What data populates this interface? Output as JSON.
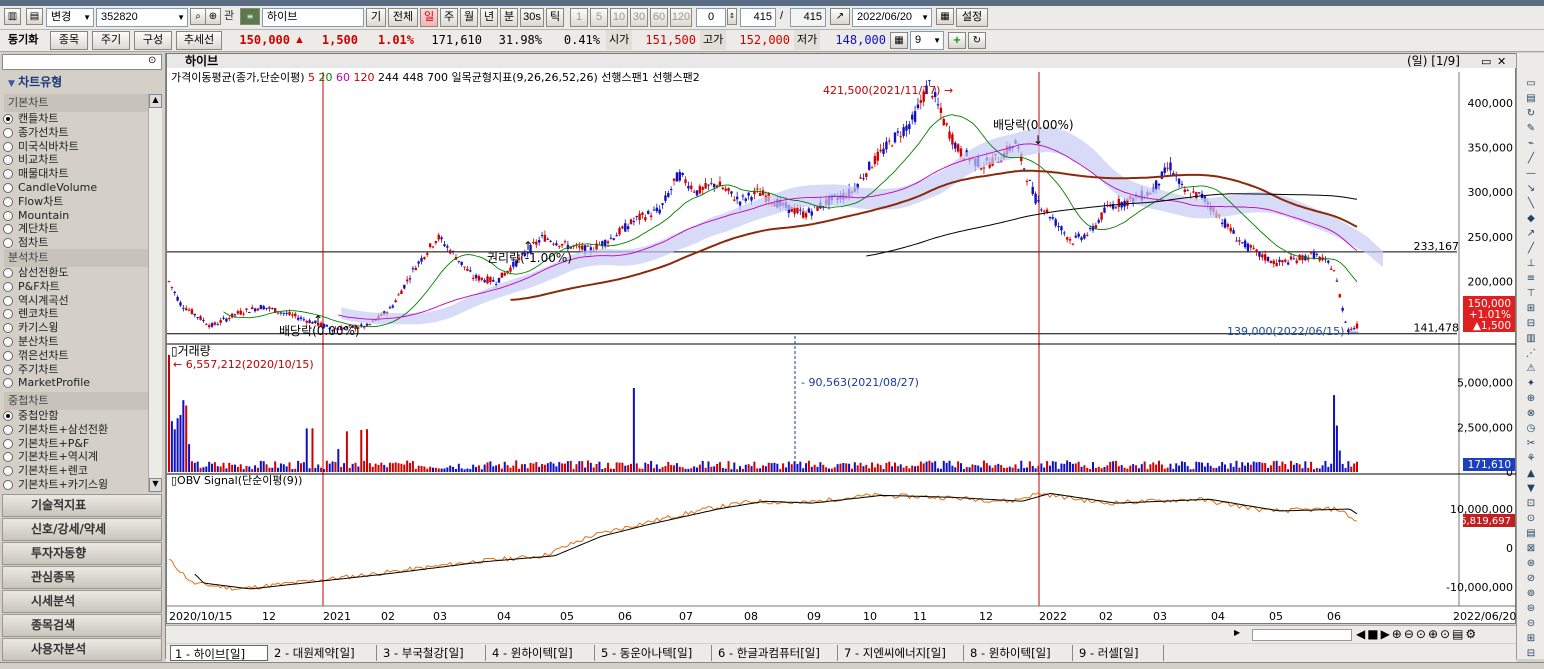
{
  "toolbar": {
    "mode_label": "변경",
    "code_value": "352820",
    "ticker_badge": "관",
    "stock_name": "하이브",
    "btn_gi": "기",
    "btn_all": "전체",
    "period_tabs": [
      "일",
      "주",
      "월",
      "년",
      "분",
      "30s",
      "틱"
    ],
    "active_period": "일",
    "number_tabs": [
      "1",
      "5",
      "10",
      "30",
      "60",
      "120"
    ],
    "zero_field": "0",
    "count_value": "415",
    "count_slash": "/",
    "count_total": "415",
    "date_value": "2022/06/20",
    "settings_label": "설정"
  },
  "quote_bar": {
    "sync_label": "동기화",
    "btn_stock": "종목",
    "btn_period": "주기",
    "btn_compose": "구성",
    "btn_trend": "추세선",
    "price": "150,000",
    "change_arrow": "▲",
    "change": "1,500",
    "change_pct": "1.01%",
    "volume": "171,610",
    "ratio1": "31.98%",
    "ratio2": "0.41%",
    "open_label": "시가",
    "open": "151,500",
    "high_label": "고가",
    "high": "152,000",
    "low_label": "저가",
    "low": "148,000",
    "grid_count": "9"
  },
  "left_panel": {
    "title": "차트유형",
    "section_basic": "기본차트",
    "basic_items": [
      "캔들차트",
      "종가선차트",
      "미국식바차트",
      "비교차트",
      "매물대차트",
      "CandleVolume",
      "Flow차트",
      "Mountain",
      "계단차트",
      "점차트"
    ],
    "section_analysis": "분석차트",
    "analysis_items": [
      "삼선전환도",
      "P&F차트",
      "역시계곡선",
      "렌코차트",
      "카기스윙",
      "분산차트",
      "꺾은선차트",
      "주기차트",
      "MarketProfile"
    ],
    "section_overlay": "중첩차트",
    "overlay_items": [
      "중첩안함",
      "기본차트+삼선전환",
      "기본차트+P&F",
      "기본차트+역시계",
      "기본차트+렌코",
      "기본차트+카기스윙"
    ],
    "menu_buttons": [
      "기술적지표",
      "신호/강세/약세",
      "투자자동향",
      "관심종목",
      "시세분석",
      "종목검색",
      "사용자분석"
    ]
  },
  "chart": {
    "panel_title": "하이브",
    "period_badge": "(일) [1/9]",
    "legend_ma_prefix": "가격이동평균(종가,단순이평)",
    "ma_periods": [
      {
        "label": "5",
        "color": "#d00000"
      },
      {
        "label": "20",
        "color": "#008000"
      },
      {
        "label": "60",
        "color": "#c000c0"
      },
      {
        "label": "120",
        "color": "#c00000"
      },
      {
        "label": "244",
        "color": "#000000"
      },
      {
        "label": "448",
        "color": "#000000"
      },
      {
        "label": "700",
        "color": "#000000"
      }
    ],
    "legend_ichimoku": "일목균형지표(9,26,26,52,26) 선행스팬1 선행스팬2",
    "annotations": {
      "high": "421,500(2021/11/17)",
      "dividend_top": "배당락(0.00%)",
      "rights": "권리락(-1.00%)",
      "dividend_bottom": "배당락(0.00%)",
      "low": "139,000(2022/06/15)",
      "line_233": "233,167",
      "line_141": "141,478"
    },
    "price_axis": [
      "400,000",
      "350,000",
      "300,000",
      "250,000",
      "200,000"
    ],
    "current_price_box": [
      "150,000",
      "+1.01%",
      "▲1,500"
    ],
    "volume_title": "거래량",
    "volume_max_note": "6,557,212(2020/10/15)",
    "volume_mid_note": "90,563(2021/08/27)",
    "volume_axis": [
      "5,000,000",
      "2,500,000",
      "0"
    ],
    "volume_current": "171,610",
    "obv_title": "OBV  Signal(단순이평(9))",
    "obv_axis": [
      "10,000,000",
      "0",
      "-10,000,000"
    ],
    "obv_current": "6,819,697",
    "x_axis": [
      "2020/10/15",
      "12",
      "2021",
      "02",
      "03",
      "04",
      "05",
      "06",
      "07",
      "08",
      "09",
      "10",
      "11",
      "12",
      "2022",
      "02",
      "03",
      "04",
      "05",
      "06",
      "2022/06/20"
    ]
  },
  "bottom_tabs": [
    "1 - 하이브[일]",
    "2 - 대원제약[일]",
    "3 - 부국철강[일]",
    "4 - 윈하이텍[일]",
    "5 - 동운아나텍[일]",
    "6 - 한글과컴퓨터[일]",
    "7 - 지엔씨에너지[일]",
    "8 - 윈하이텍[일]",
    "9 - 러셀[일]"
  ],
  "active_tab": "1 - 하이브[일]",
  "colors": {
    "up": "#d00000",
    "down": "#1010c0",
    "accent": "#c00000"
  }
}
